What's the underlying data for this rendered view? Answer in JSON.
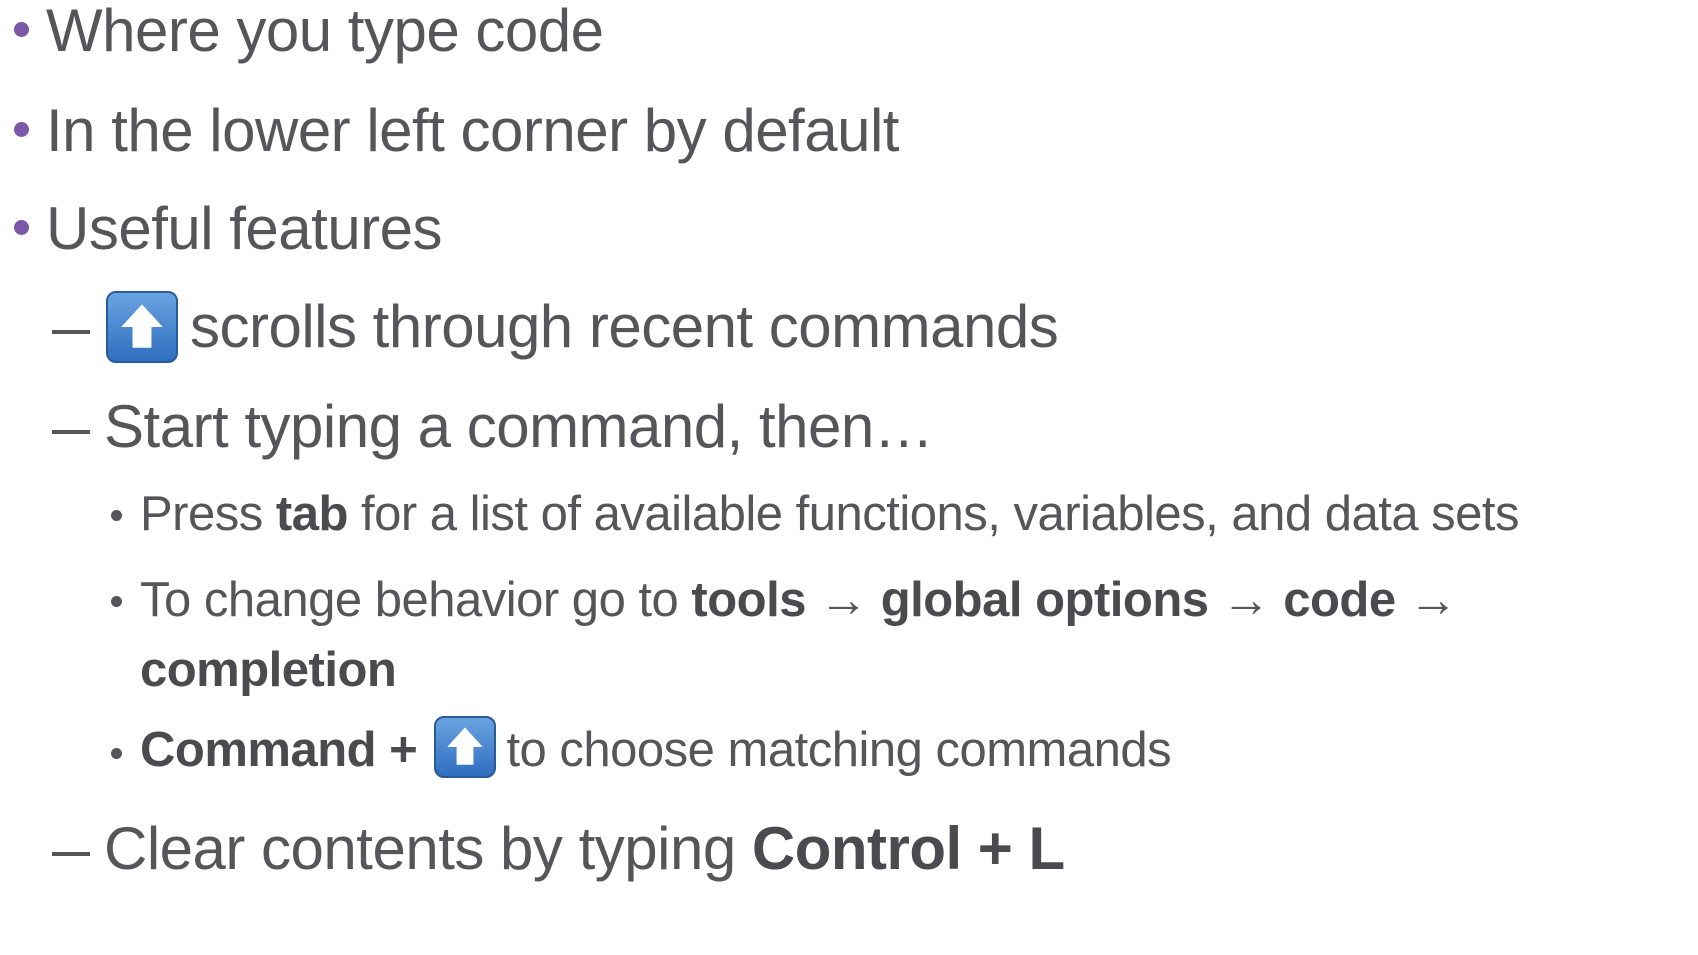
{
  "bullets": {
    "b1": "Where you type code",
    "b2": "In the lower left corner by default",
    "b3": "Useful features"
  },
  "sub": {
    "s1_text": "scrolls through recent commands",
    "s2": "Start typing a command, then…",
    "s3_pre": "Clear contents by typing ",
    "s3_bold": "Control + L"
  },
  "subsub": {
    "t1_pre": "Press ",
    "t1_bold": "tab",
    "t1_post": " for a list of available functions, variables, and data sets",
    "t2_pre": "To change behavior go to ",
    "t2_b1": "tools",
    "t2_arrow1": " → ",
    "t2_b2": "global options",
    "t2_arrow2": " → ",
    "t2_b3": "code",
    "t2_arrow3": " →",
    "t2_b4": "completion",
    "t3_bold": "Command +",
    "t3_post": "to choose matching commands"
  },
  "icons": {
    "up_key": "up-arrow-key-icon",
    "key_color": "#3b7fd0"
  },
  "colors": {
    "text": "#55555a",
    "bullet": "#7b57a8"
  }
}
